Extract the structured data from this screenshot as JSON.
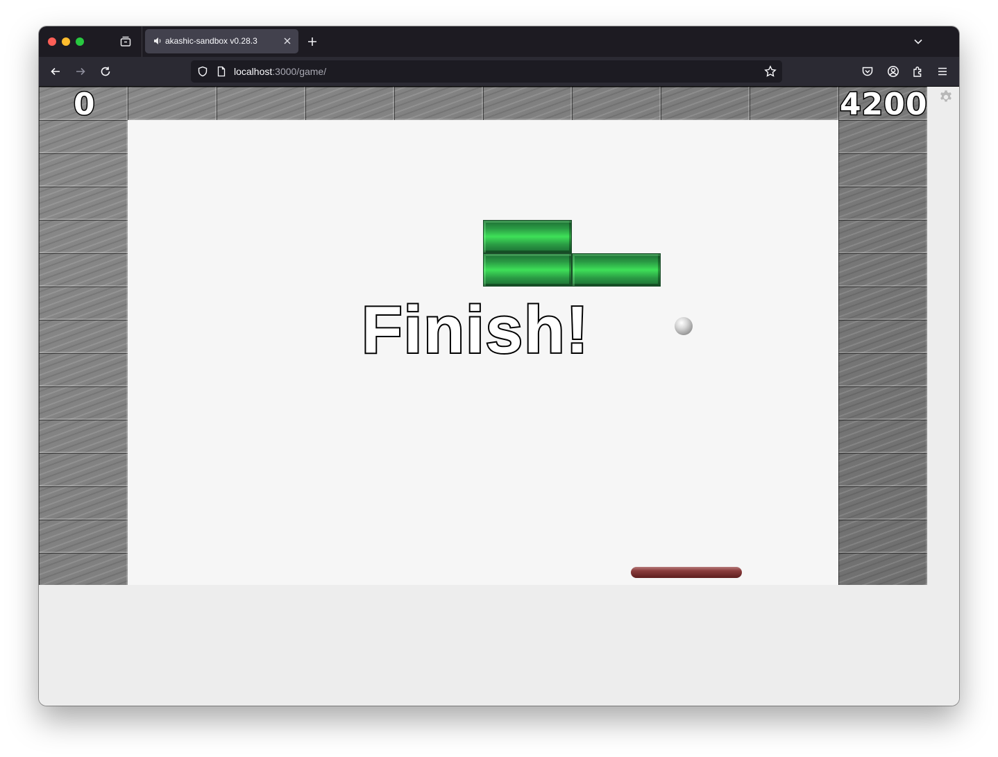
{
  "browser": {
    "tab_title": "akashic-sandbox v0.28.3",
    "url_host": "localhost",
    "url_path": ":3000/game/",
    "icons": {
      "tab_overview": "tab-overview-icon",
      "tab_audio": "speaker-icon",
      "tab_close": "close-icon",
      "new_tab": "plus-icon",
      "tab_list": "chevron-down-icon",
      "back": "arrow-left-icon",
      "forward": "arrow-right-icon",
      "reload": "reload-icon",
      "tracking": "shield-icon",
      "page": "page-icon",
      "bookmark": "star-icon",
      "pocket": "pocket-icon",
      "account": "account-icon",
      "extensions": "puzzle-icon",
      "menu": "hamburger-icon"
    }
  },
  "game": {
    "score_left": "0",
    "score_right": "4200",
    "finish_text": "Finish!",
    "colors": {
      "brick": "#2e9e47",
      "paddle": "#7a2f2f",
      "ball": "#c8c8c8",
      "playfield": "#f6f6f6",
      "wall": "#7c7c7c"
    },
    "settings_icon": "gear-icon"
  }
}
